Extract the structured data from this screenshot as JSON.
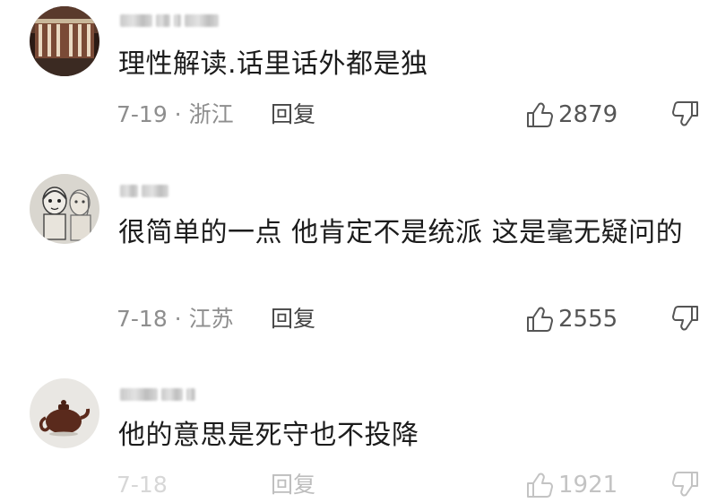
{
  "comments": [
    {
      "username": "",
      "text": "理性解读.话里话外都是独",
      "date": "7-19 · 浙江",
      "reply_label": "回复",
      "likes": "2879"
    },
    {
      "username": "",
      "text": "很简单的一点 他肯定不是统派 这是毫无疑问的",
      "date": "7-18 · 江苏",
      "reply_label": "回复",
      "likes": "2555"
    },
    {
      "username": "",
      "text": "他的意思是死守也不投降",
      "date": "7-18",
      "reply_label": "回复",
      "likes": "1921"
    }
  ],
  "icons": {
    "like": "thumbs-up-icon",
    "dislike": "thumbs-down-icon"
  },
  "colors": {
    "text": "#1c1c1c",
    "meta": "#8e8e8e",
    "reply": "#454545"
  }
}
